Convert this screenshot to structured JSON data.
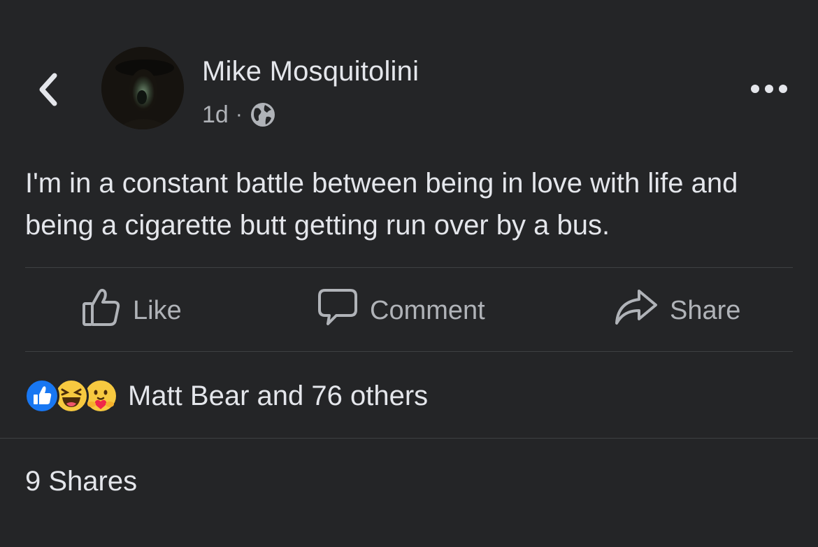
{
  "post": {
    "author": "Mike Mosquitolini",
    "time": "1d",
    "separator": "·",
    "privacy_icon": "globe-icon",
    "text": "I'm in a constant battle between being in love with life and being a cigarette butt getting run over by a bus."
  },
  "header": {
    "back_icon": "chevron-left-icon",
    "more_icon": "ellipsis-icon"
  },
  "actions": {
    "like_label": "Like",
    "comment_label": "Comment",
    "share_label": "Share"
  },
  "reactions": {
    "icons": [
      "like-reaction-icon",
      "haha-reaction-icon",
      "care-reaction-icon"
    ],
    "summary": "Matt Bear and 76 others"
  },
  "shares": {
    "label": "9 Shares"
  },
  "colors": {
    "background": "#242527",
    "text_primary": "#e4e6eb",
    "text_secondary": "#b0b3b8",
    "divider": "#3e4042",
    "like_blue": "#1877f2",
    "reaction_yellow": "#f7c940"
  }
}
